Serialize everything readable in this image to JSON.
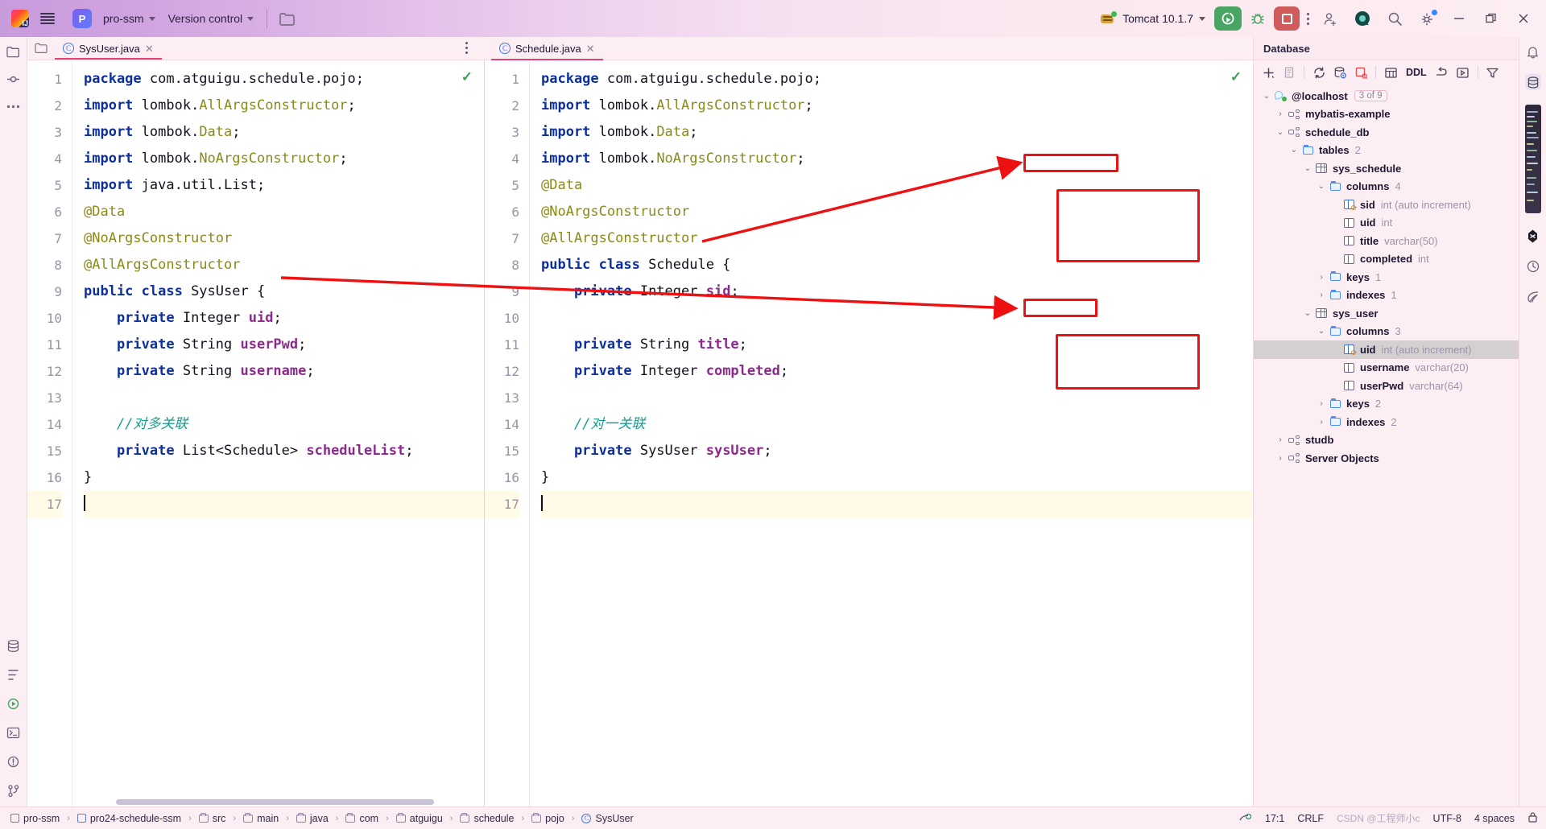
{
  "titlebar": {
    "project_name": "pro-ssm",
    "vcs_label": "Version control",
    "run_config": "Tomcat 10.1.7",
    "icons": {
      "menu": "hamburger-menu-icon",
      "project": "project-badge-icon",
      "folder": "open-folder-icon",
      "run": "run-icon",
      "debug": "debug-icon",
      "stop": "stop-icon",
      "more": "more-options-icon",
      "add_user": "add-user-icon",
      "account": "account-avatar-icon",
      "search": "search-icon",
      "settings": "settings-gear-icon",
      "minimize": "minimize-icon",
      "maximize": "maximize-icon",
      "close": "close-icon"
    }
  },
  "editor": {
    "tabs": [
      {
        "label": "SysUser.java",
        "icon": "java-class-icon",
        "active": true
      },
      {
        "label": "Schedule.java",
        "icon": "java-class-icon",
        "active": false
      }
    ],
    "panes": [
      {
        "file": "SysUser.java",
        "inspection_status": "ok",
        "lines": [
          {
            "n": "1",
            "tokens": [
              {
                "t": "package",
                "c": "kw"
              },
              {
                "t": " com.atguigu.schedule.pojo;",
                "c": "pln"
              }
            ]
          },
          {
            "n": "2",
            "tokens": [
              {
                "t": "import",
                "c": "kw"
              },
              {
                "t": " lombok.",
                "c": "pln"
              },
              {
                "t": "AllArgsConstructor",
                "c": "cls"
              },
              {
                "t": ";",
                "c": "pln"
              }
            ]
          },
          {
            "n": "3",
            "tokens": [
              {
                "t": "import",
                "c": "kw"
              },
              {
                "t": " lombok.",
                "c": "pln"
              },
              {
                "t": "Data",
                "c": "cls"
              },
              {
                "t": ";",
                "c": "pln"
              }
            ]
          },
          {
            "n": "4",
            "tokens": [
              {
                "t": "import",
                "c": "kw"
              },
              {
                "t": " lombok.",
                "c": "pln"
              },
              {
                "t": "NoArgsConstructor",
                "c": "cls"
              },
              {
                "t": ";",
                "c": "pln"
              }
            ]
          },
          {
            "n": "5",
            "tokens": [
              {
                "t": "import",
                "c": "kw"
              },
              {
                "t": " java.util.List;",
                "c": "pln"
              }
            ]
          },
          {
            "n": "6",
            "tokens": [
              {
                "t": "@Data",
                "c": "ann"
              }
            ]
          },
          {
            "n": "7",
            "tokens": [
              {
                "t": "@NoArgsConstructor",
                "c": "ann"
              }
            ]
          },
          {
            "n": "8",
            "tokens": [
              {
                "t": "@AllArgsConstructor",
                "c": "ann"
              }
            ]
          },
          {
            "n": "9",
            "tokens": [
              {
                "t": "public class",
                "c": "kw"
              },
              {
                "t": " SysUser {",
                "c": "pln"
              }
            ]
          },
          {
            "n": "10",
            "tokens": [
              {
                "t": "    private",
                "c": "kw"
              },
              {
                "t": " Integer ",
                "c": "pln"
              },
              {
                "t": "uid",
                "c": "fld"
              },
              {
                "t": ";",
                "c": "pln"
              }
            ]
          },
          {
            "n": "11",
            "tokens": [
              {
                "t": "    private",
                "c": "kw"
              },
              {
                "t": " String ",
                "c": "pln"
              },
              {
                "t": "userPwd",
                "c": "fld"
              },
              {
                "t": ";",
                "c": "pln"
              }
            ]
          },
          {
            "n": "12",
            "tokens": [
              {
                "t": "    private",
                "c": "kw"
              },
              {
                "t": " String ",
                "c": "pln"
              },
              {
                "t": "username",
                "c": "fld"
              },
              {
                "t": ";",
                "c": "pln"
              }
            ]
          },
          {
            "n": "13",
            "tokens": [
              {
                "t": "",
                "c": "pln"
              }
            ]
          },
          {
            "n": "14",
            "tokens": [
              {
                "t": "    //对多关联",
                "c": "cmt"
              }
            ]
          },
          {
            "n": "15",
            "tokens": [
              {
                "t": "    private",
                "c": "kw"
              },
              {
                "t": " List<Schedule> ",
                "c": "pln"
              },
              {
                "t": "scheduleList",
                "c": "fld"
              },
              {
                "t": ";",
                "c": "pln"
              }
            ]
          },
          {
            "n": "16",
            "tokens": [
              {
                "t": "}",
                "c": "pln"
              }
            ]
          },
          {
            "n": "17",
            "tokens": [
              {
                "t": "",
                "c": "pln"
              }
            ],
            "highlight": true
          }
        ]
      },
      {
        "file": "Schedule.java",
        "inspection_status": "ok",
        "lines": [
          {
            "n": "1",
            "tokens": [
              {
                "t": "package",
                "c": "kw"
              },
              {
                "t": " com.atguigu.schedule.pojo;",
                "c": "pln"
              }
            ]
          },
          {
            "n": "2",
            "tokens": [
              {
                "t": "import",
                "c": "kw"
              },
              {
                "t": " lombok.",
                "c": "pln"
              },
              {
                "t": "AllArgsConstructor",
                "c": "cls"
              },
              {
                "t": ";",
                "c": "pln"
              }
            ]
          },
          {
            "n": "3",
            "tokens": [
              {
                "t": "import",
                "c": "kw"
              },
              {
                "t": " lombok.",
                "c": "pln"
              },
              {
                "t": "Data",
                "c": "cls"
              },
              {
                "t": ";",
                "c": "pln"
              }
            ]
          },
          {
            "n": "4",
            "tokens": [
              {
                "t": "import",
                "c": "kw"
              },
              {
                "t": " lombok.",
                "c": "pln"
              },
              {
                "t": "NoArgsConstructor",
                "c": "cls"
              },
              {
                "t": ";",
                "c": "pln"
              }
            ]
          },
          {
            "n": "5",
            "tokens": [
              {
                "t": "@Data",
                "c": "ann"
              }
            ]
          },
          {
            "n": "6",
            "tokens": [
              {
                "t": "@NoArgsConstructor",
                "c": "ann"
              }
            ]
          },
          {
            "n": "7",
            "tokens": [
              {
                "t": "@AllArgsConstructor",
                "c": "ann"
              }
            ]
          },
          {
            "n": "8",
            "tokens": [
              {
                "t": "public class",
                "c": "kw"
              },
              {
                "t": " Schedule {",
                "c": "pln"
              }
            ]
          },
          {
            "n": "9",
            "tokens": [
              {
                "t": "    private",
                "c": "kw"
              },
              {
                "t": " Integer ",
                "c": "pln"
              },
              {
                "t": "sid",
                "c": "fld"
              },
              {
                "t": ";",
                "c": "pln"
              }
            ]
          },
          {
            "n": "10",
            "tokens": [
              {
                "t": "",
                "c": "pln"
              }
            ]
          },
          {
            "n": "11",
            "tokens": [
              {
                "t": "    private",
                "c": "kw"
              },
              {
                "t": " String ",
                "c": "pln"
              },
              {
                "t": "title",
                "c": "fld"
              },
              {
                "t": ";",
                "c": "pln"
              }
            ]
          },
          {
            "n": "12",
            "tokens": [
              {
                "t": "    private",
                "c": "kw"
              },
              {
                "t": " Integer ",
                "c": "pln"
              },
              {
                "t": "completed",
                "c": "fld"
              },
              {
                "t": ";",
                "c": "pln"
              }
            ]
          },
          {
            "n": "13",
            "tokens": [
              {
                "t": "",
                "c": "pln"
              }
            ]
          },
          {
            "n": "14",
            "tokens": [
              {
                "t": "    //对一关联",
                "c": "cmt"
              }
            ]
          },
          {
            "n": "15",
            "tokens": [
              {
                "t": "    private",
                "c": "kw"
              },
              {
                "t": " SysUser ",
                "c": "pln"
              },
              {
                "t": "sysUser",
                "c": "fld"
              },
              {
                "t": ";",
                "c": "pln"
              }
            ]
          },
          {
            "n": "16",
            "tokens": [
              {
                "t": "}",
                "c": "pln"
              }
            ]
          },
          {
            "n": "17",
            "tokens": [
              {
                "t": "",
                "c": "pln"
              }
            ],
            "highlight": true
          }
        ]
      }
    ]
  },
  "database": {
    "title": "Database",
    "toolbar": {
      "add": "add-icon",
      "copy": "duplicate-icon",
      "refresh": "refresh-icon",
      "db_settings": "database-settings-icon",
      "new_query": "new-query-icon",
      "table_view": "table-view-icon",
      "ddl_label": "DDL",
      "jump": "jump-to-icon",
      "console": "open-console-icon",
      "filter": "filter-icon"
    },
    "tree": [
      {
        "indent": 0,
        "arrow": "down",
        "icon": "connection-icon",
        "label": "@localhost",
        "badge": "3 of 9",
        "meta": ""
      },
      {
        "indent": 1,
        "arrow": "right",
        "icon": "schema-icon",
        "label": "mybatis-example",
        "meta": ""
      },
      {
        "indent": 1,
        "arrow": "down",
        "icon": "schema-icon",
        "label": "schedule_db",
        "meta": ""
      },
      {
        "indent": 2,
        "arrow": "down",
        "icon": "folder-icon",
        "label": "tables",
        "meta": "2"
      },
      {
        "indent": 3,
        "arrow": "down",
        "icon": "table-icon",
        "label": "sys_schedule",
        "meta": "",
        "boxed": true
      },
      {
        "indent": 4,
        "arrow": "down",
        "icon": "folder-icon",
        "label": "columns",
        "meta": "4"
      },
      {
        "indent": 5,
        "arrow": "none",
        "icon": "primary-key-column-icon",
        "label": "sid",
        "meta": "int (auto increment)"
      },
      {
        "indent": 5,
        "arrow": "none",
        "icon": "column-icon",
        "label": "uid",
        "meta": "int"
      },
      {
        "indent": 5,
        "arrow": "none",
        "icon": "column-icon",
        "label": "title",
        "meta": "varchar(50)"
      },
      {
        "indent": 5,
        "arrow": "none",
        "icon": "column-icon",
        "label": "completed",
        "meta": "int"
      },
      {
        "indent": 4,
        "arrow": "right",
        "icon": "folder-icon",
        "label": "keys",
        "meta": "1"
      },
      {
        "indent": 4,
        "arrow": "right",
        "icon": "folder-icon",
        "label": "indexes",
        "meta": "1"
      },
      {
        "indent": 3,
        "arrow": "down",
        "icon": "table-icon",
        "label": "sys_user",
        "meta": "",
        "boxed": true
      },
      {
        "indent": 4,
        "arrow": "down",
        "icon": "folder-icon",
        "label": "columns",
        "meta": "3"
      },
      {
        "indent": 5,
        "arrow": "none",
        "icon": "primary-key-column-icon",
        "label": "uid",
        "meta": "int (auto increment)",
        "selected": true
      },
      {
        "indent": 5,
        "arrow": "none",
        "icon": "column-icon",
        "label": "username",
        "meta": "varchar(20)"
      },
      {
        "indent": 5,
        "arrow": "none",
        "icon": "column-icon",
        "label": "userPwd",
        "meta": "varchar(64)"
      },
      {
        "indent": 4,
        "arrow": "right",
        "icon": "folder-icon",
        "label": "keys",
        "meta": "2"
      },
      {
        "indent": 4,
        "arrow": "right",
        "icon": "folder-icon",
        "label": "indexes",
        "meta": "2"
      },
      {
        "indent": 1,
        "arrow": "right",
        "icon": "schema-icon",
        "label": "studb",
        "meta": ""
      },
      {
        "indent": 1,
        "arrow": "right",
        "icon": "server-objects-icon",
        "label": "Server Objects",
        "meta": ""
      }
    ]
  },
  "statusbar": {
    "breadcrumbs": [
      {
        "label": "pro-ssm",
        "icon": "module-icon"
      },
      {
        "label": "pro24-schedule-ssm",
        "icon": "module-icon"
      },
      {
        "label": "src",
        "icon": "folder-icon"
      },
      {
        "label": "main",
        "icon": "folder-icon"
      },
      {
        "label": "java",
        "icon": "folder-icon"
      },
      {
        "label": "com",
        "icon": "folder-icon"
      },
      {
        "label": "atguigu",
        "icon": "folder-icon"
      },
      {
        "label": "schedule",
        "icon": "folder-icon"
      },
      {
        "label": "pojo",
        "icon": "folder-icon"
      },
      {
        "label": "SysUser",
        "icon": "java-class-icon"
      }
    ],
    "caret_position": "17:1",
    "line_separator": "CRLF",
    "encoding": "UTF-8",
    "indent": "4 spaces",
    "watermark": "CSDN @工程师小c"
  },
  "colors": {
    "accent_red": "#ee1111",
    "keyword": "#0d2f9e",
    "annotation": "#8a8a16",
    "field": "#8c2a8c",
    "comment": "#179b8e",
    "panel_bg": "#fdeef3",
    "run_green": "#4aa564",
    "stop_red": "#cf5b5b"
  }
}
